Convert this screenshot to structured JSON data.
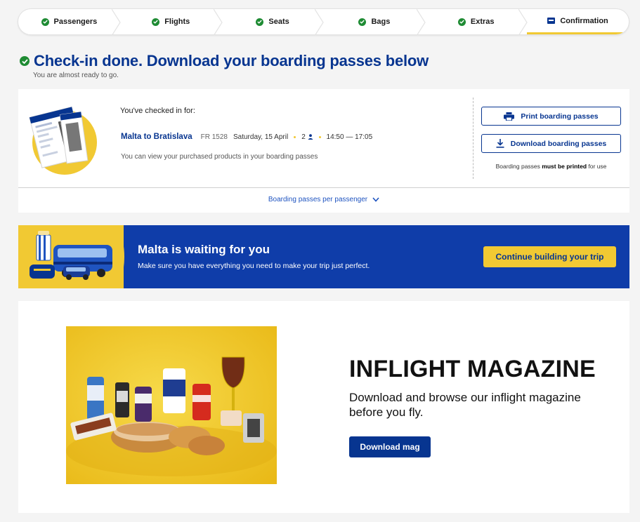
{
  "stepper": {
    "steps": [
      {
        "label": "Passengers",
        "state": "done"
      },
      {
        "label": "Flights",
        "state": "done"
      },
      {
        "label": "Seats",
        "state": "done"
      },
      {
        "label": "Bags",
        "state": "done"
      },
      {
        "label": "Extras",
        "state": "done"
      },
      {
        "label": "Confirmation",
        "state": "active"
      }
    ]
  },
  "header": {
    "title": "Check-in done. Download your boarding passes below",
    "subtitle": "You are almost ready to go."
  },
  "boarding": {
    "checked_in_label": "You've checked in for:",
    "route": "Malta to Bratislava",
    "flight_number": "FR 1528",
    "date": "Saturday, 15 April",
    "passengers": "2",
    "times": "14:50 — 17:05",
    "note": "You can view your purchased products in your boarding passes",
    "print_button": "Print boarding passes",
    "download_button": "Download boarding passes",
    "print_note_prefix": "Boarding passes",
    "print_note_bold": "must be printed",
    "print_note_suffix": "for use",
    "per_passenger_toggle": "Boarding passes per passenger"
  },
  "banner": {
    "title": "Malta is waiting for you",
    "text": "Make sure you have everything you need to make your trip just perfect.",
    "button": "Continue building your trip"
  },
  "magazine": {
    "title": "INFLIGHT MAGAZINE",
    "description": "Download and browse our inflight magazine before you fly.",
    "button": "Download mag"
  },
  "colors": {
    "brand_blue": "#073590",
    "brand_yellow": "#f1c933",
    "success_green": "#1e8b33",
    "link_blue": "#1f54c0",
    "banner_blue": "#0f3da9"
  }
}
